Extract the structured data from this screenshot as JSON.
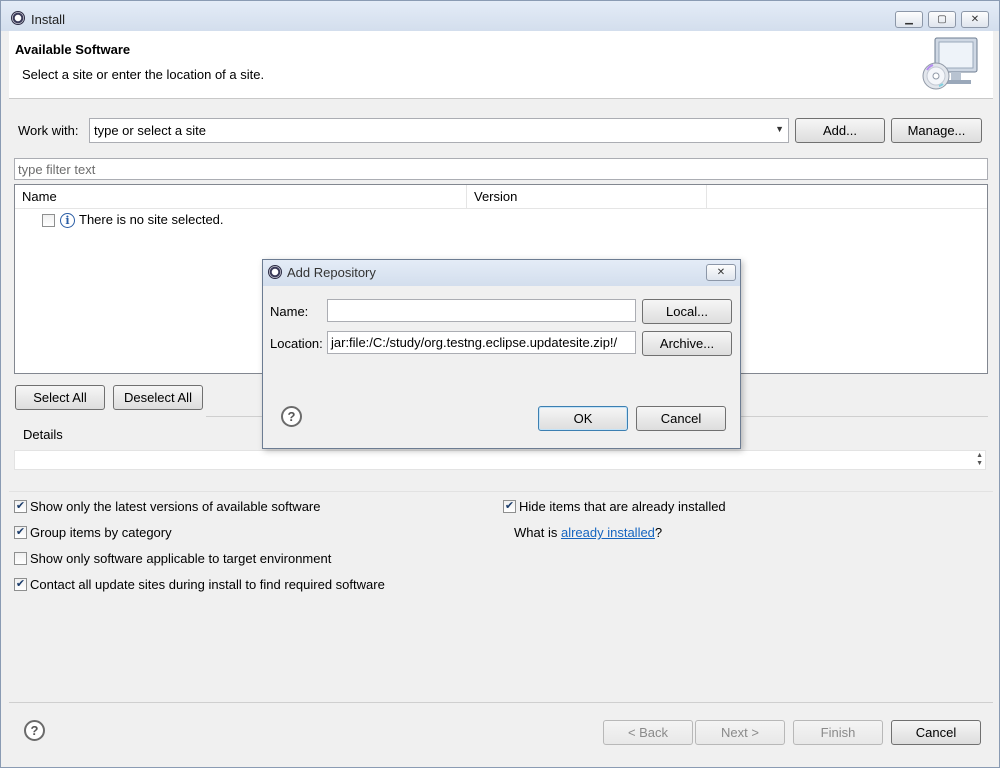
{
  "window": {
    "title": "Install",
    "minimize_label": "▁",
    "maximize_label": "▢",
    "close_label": "✕"
  },
  "header": {
    "title": "Available Software",
    "description": "Select a site or enter the location of a site."
  },
  "work_with": {
    "label": "Work with:",
    "combo_value": "type or select a site",
    "add_label": "Add...",
    "manage_label": "Manage..."
  },
  "filter": {
    "placeholder": "type filter text"
  },
  "tree": {
    "columns": [
      "Name",
      "Version"
    ],
    "rows": [
      {
        "checked": false,
        "icon": "info-icon",
        "text": "There is no site selected."
      }
    ]
  },
  "selection_buttons": {
    "select_all": "Select All",
    "deselect_all": "Deselect All"
  },
  "details": {
    "label": "Details"
  },
  "options": {
    "latest_versions": {
      "label": "Show only the latest versions of available software",
      "checked": true
    },
    "group_by_category": {
      "label": "Group items by category",
      "checked": true
    },
    "applicable_only": {
      "label": "Show only software applicable to target environment",
      "checked": false
    },
    "contact_all_sites": {
      "label": "Contact all update sites during install to find required software",
      "checked": true
    },
    "hide_installed": {
      "label": "Hide items that are already installed",
      "checked": true
    },
    "what_is_prefix": "What is ",
    "already_installed_link": "already installed",
    "what_is_suffix": "?"
  },
  "footer": {
    "back": "< Back",
    "next": "Next >",
    "finish": "Finish",
    "cancel": "Cancel"
  },
  "dialog": {
    "title": "Add Repository",
    "close_label": "✕",
    "name_label": "Name:",
    "name_value": "",
    "location_label": "Location:",
    "location_value": "jar:file:/C:/study/org.testng.eclipse.updatesite.zip!/",
    "local_button": "Local...",
    "archive_button": "Archive...",
    "ok_button": "OK",
    "cancel_button": "Cancel"
  },
  "help_icon_glyph": "?",
  "check_glyph": "✔",
  "info_glyph": "i"
}
